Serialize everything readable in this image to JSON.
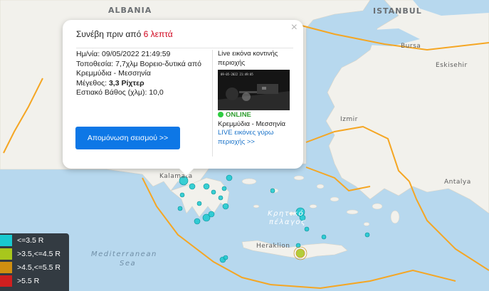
{
  "map": {
    "labels": {
      "albania": "ALBANIA",
      "istanbul": "ISTANBUL",
      "bursa": "Bursa",
      "eskisehir": "Eskisehir",
      "izmir": "Izmir",
      "antalya": "Antalya",
      "kalamata": "Kalamata",
      "cretan_sea": "Κρητικό",
      "cretan_sea2": "πέλαγος",
      "heraklion": "Heraklion",
      "med_sea": "Mediterranean",
      "med_sea2": "Sea"
    },
    "colors": {
      "land": "#f2f1ec",
      "sea": "#b7d8ee",
      "fault": "#f5a623",
      "quake_low": "#19c9cf"
    }
  },
  "popup": {
    "close_label": "×",
    "title_prefix": "Συνέβη πριν από",
    "title_ago": "6 λεπτά",
    "datetime": "Ημ/νία: 09/05/2022 21:49:59",
    "location": "Τοποθεσία: 7,7χλμ Βορειο-δυτικά από Κρεμμύδια - Μεσσηνία",
    "magnitude_label": "Μέγεθος: ",
    "magnitude_value": "3,3 Ρίχτερ",
    "depth": "Εστιακό Βάθος (χλμ): 10,0",
    "live_title": "Live εικόνα κοντινής περιοχής",
    "cam_timestamp": "09-05-2022 21:49:05",
    "online": "ONLINE",
    "cam_place": "Κρεμμύδια - Μεσσηνία",
    "live_link": "LIVE εικόνες γύρω περιοχής >>",
    "isolate_button": "Απομόνωση σεισμού >>"
  },
  "legend": {
    "items": [
      {
        "label": "<=3.5 R",
        "color": "#19c9cf"
      },
      {
        "label": ">3.5,<=4.5 R",
        "color": "#a8c71c"
      },
      {
        "label": ">4.5,<=5.5 R",
        "color": "#d08f10"
      },
      {
        "label": ">5.5 R",
        "color": "#d01f1f"
      }
    ]
  }
}
